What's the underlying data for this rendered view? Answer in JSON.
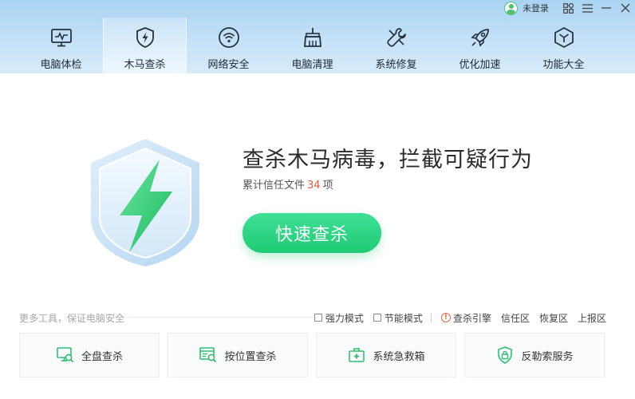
{
  "titlebar": {
    "user_label": "未登录",
    "icons": [
      "avatar-icon",
      "skin-icon",
      "menu-icon",
      "minimize-icon",
      "close-icon"
    ]
  },
  "nav": {
    "active": "木马查杀",
    "items": [
      {
        "label": "电脑体检",
        "icon": "monitor-icon"
      },
      {
        "label": "木马查杀",
        "icon": "shield-bolt-icon"
      },
      {
        "label": "网络安全",
        "icon": "wifi-icon"
      },
      {
        "label": "电脑清理",
        "icon": "broom-icon"
      },
      {
        "label": "系统修复",
        "icon": "wrench-icon"
      },
      {
        "label": "优化加速",
        "icon": "rocket-icon"
      },
      {
        "label": "功能大全",
        "icon": "cube-icon"
      }
    ]
  },
  "hero": {
    "title": "查杀木马病毒，拦截可疑行为",
    "sub_prefix": "累计信任文件",
    "sub_count": "34",
    "sub_suffix": "项",
    "scan_button": "快速查杀"
  },
  "tools": {
    "section_label": "更多工具，保证电脑安全",
    "options": {
      "strong_mode": "强力模式",
      "power_save_mode": "节能模式",
      "engine": "查杀引擎",
      "trust_zone": "信任区",
      "restore_zone": "恢复区",
      "report_zone": "上报区"
    },
    "cards": [
      {
        "label": "全盘查杀",
        "icon": "full-scan-icon"
      },
      {
        "label": "按位置查杀",
        "icon": "location-scan-icon"
      },
      {
        "label": "系统急救箱",
        "icon": "first-aid-icon"
      },
      {
        "label": "反勒索服务",
        "icon": "anti-ransom-shield-icon"
      }
    ]
  },
  "colors": {
    "accent_green": "#1fcb74",
    "header_blue": "#a9d3f3",
    "count_red": "#e25c3a"
  }
}
